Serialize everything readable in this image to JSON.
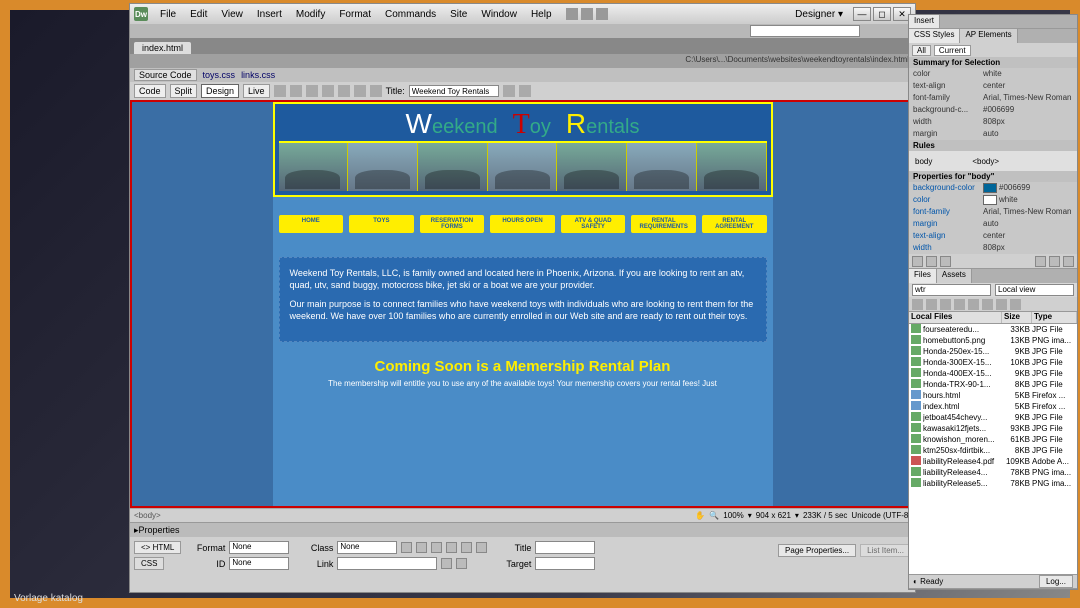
{
  "app": {
    "icon_letter": "Dw",
    "designer_label": "Designer  ▾"
  },
  "menus": [
    "File",
    "Edit",
    "View",
    "Insert",
    "Modify",
    "Format",
    "Commands",
    "Site",
    "Window",
    "Help"
  ],
  "doc_tab": "index.html",
  "path_bar": "C:\\Users\\...\\Documents\\websites\\weekendtoyrentals\\index.html",
  "source_row": {
    "label": "Source Code",
    "links": [
      "toys.css",
      "links.css"
    ]
  },
  "view_btns": [
    "Code",
    "Split",
    "Design",
    "Live"
  ],
  "title_label": "Title:",
  "title_value": "Weekend Toy Rentals",
  "brand": {
    "w": "W",
    "t1": "eekend",
    "t": "T",
    "t2": "oy",
    "r": "R",
    "t3": "entals"
  },
  "nav_btns": [
    "HOME",
    "TOYS",
    "RESERVATION FORMS",
    "HOURS OPEN",
    "ATV & QUAD SAFETY",
    "RENTAL REQUIREMENTS",
    "RENTAL AGREEMENT"
  ],
  "para1": "Weekend Toy Rentals, LLC, is family owned and located here in Phoenix, Arizona. If you are looking to rent an atv, quad, utv, sand buggy, motocross bike, jet ski or a boat we are your provider.",
  "para2": "Our main purpose is to connect families who have weekend toys with individuals who are looking to rent them for the weekend. We have over 100 families who are currently enrolled in our Web site and are ready to rent out their toys.",
  "coming_soon": "Coming Soon is a Memership Rental Plan",
  "coming_sub": "The membership will entitle you to use any of the available toys! Your memership covers your rental fees! Just",
  "status": {
    "tag": "<body>",
    "zoom": "100%",
    "dims": "904 x 621",
    "size_time": "233K / 5 sec",
    "encoding": "Unicode (UTF-8)"
  },
  "props": {
    "title": "Properties",
    "html_btn": "<> HTML",
    "css_btn": "CSS",
    "format_lbl": "Format",
    "format_val": "None",
    "id_lbl": "ID",
    "id_val": "None",
    "class_lbl": "Class",
    "class_val": "None",
    "link_lbl": "Link",
    "link_val": "",
    "title_lbl": "Title",
    "title_val": "",
    "target_lbl": "Target",
    "target_val": "",
    "page_props": "Page Properties...",
    "list_item": "List Item..."
  },
  "right": {
    "insert_tab": "Insert",
    "css_tab": "CSS Styles",
    "ap_tab": "AP Elements",
    "all_btn": "All",
    "current_btn": "Current",
    "summary_title": "Summary for Selection",
    "summary": [
      {
        "k": "color",
        "v": "white"
      },
      {
        "k": "text-align",
        "v": "center"
      },
      {
        "k": "font-family",
        "v": "Arial, Times-New Roman"
      },
      {
        "k": "background-c...",
        "v": "#006699"
      },
      {
        "k": "width",
        "v": "808px"
      },
      {
        "k": "margin",
        "v": "auto"
      }
    ],
    "rules_title": "Rules",
    "rules": {
      "sel": "body",
      "tag": "<body>"
    },
    "propsfor_title": "Properties for \"body\"",
    "propsfor": [
      {
        "k": "background-color",
        "v": "#006699",
        "sw": "#006699"
      },
      {
        "k": "color",
        "v": "white",
        "sw": "#ffffff"
      },
      {
        "k": "font-family",
        "v": "Arial, Times-New Roman"
      },
      {
        "k": "margin",
        "v": "auto"
      },
      {
        "k": "text-align",
        "v": "center"
      },
      {
        "k": "width",
        "v": "808px"
      }
    ],
    "files_tab": "Files",
    "assets_tab": "Assets",
    "site_sel": "wtr",
    "view_sel": "Local view",
    "col_name": "Local Files",
    "col_size": "Size",
    "col_type": "Type",
    "files": [
      {
        "ic": "img",
        "n": "fourseateredu...",
        "s": "33KB",
        "t": "JPG File"
      },
      {
        "ic": "img",
        "n": "homebutton5.png",
        "s": "13KB",
        "t": "PNG ima..."
      },
      {
        "ic": "img",
        "n": "Honda-250ex-15...",
        "s": "9KB",
        "t": "JPG File"
      },
      {
        "ic": "img",
        "n": "Honda-300EX-15...",
        "s": "10KB",
        "t": "JPG File"
      },
      {
        "ic": "img",
        "n": "Honda-400EX-15...",
        "s": "9KB",
        "t": "JPG File"
      },
      {
        "ic": "img",
        "n": "Honda-TRX-90-1...",
        "s": "8KB",
        "t": "JPG File"
      },
      {
        "ic": "htm",
        "n": "hours.html",
        "s": "5KB",
        "t": "Firefox ..."
      },
      {
        "ic": "htm",
        "n": "index.html",
        "s": "5KB",
        "t": "Firefox ..."
      },
      {
        "ic": "img",
        "n": "jetboat454chevy...",
        "s": "9KB",
        "t": "JPG File"
      },
      {
        "ic": "img",
        "n": "kawasaki12fjets...",
        "s": "93KB",
        "t": "JPG File"
      },
      {
        "ic": "img",
        "n": "knowishon_moren...",
        "s": "61KB",
        "t": "JPG File"
      },
      {
        "ic": "img",
        "n": "ktm250sx-fdirtbik...",
        "s": "8KB",
        "t": "JPG File"
      },
      {
        "ic": "pdf",
        "n": "liabilityRelease4.pdf",
        "s": "109KB",
        "t": "Adobe A..."
      },
      {
        "ic": "img",
        "n": "liabilityRelease4...",
        "s": "78KB",
        "t": "PNG ima..."
      },
      {
        "ic": "img",
        "n": "liabilityRelease5...",
        "s": "78KB",
        "t": "PNG ima..."
      }
    ],
    "ready": "Ready",
    "log": "Log..."
  },
  "caption": "Vorlage katalog"
}
